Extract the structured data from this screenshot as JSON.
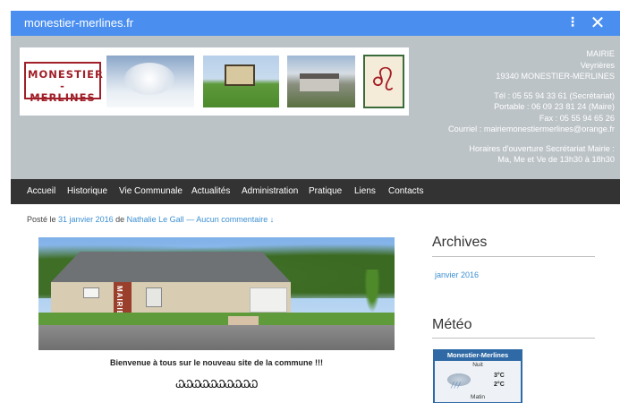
{
  "chrome": {
    "url": "monestier-merlines.fr",
    "menu_glyph": "⋮",
    "close_glyph": "✕",
    "bar_color": "#4a8ff0"
  },
  "header": {
    "logo_line1": "MONESTIER",
    "logo_line2": "- MERLINES",
    "contact": {
      "line1": "MAIRIE",
      "line2": "Veyrières",
      "line3": "19340 MONESTIER-MERLINES",
      "tel": "Tél : 05 55 94 33 61 (Secrétariat)",
      "portable": "Portable : 06 09 23 81 24 (Maire)",
      "fax": "Fax : 05 55 94 65 26",
      "courriel": "Courriel : mairiemonestiermerlines@orange.fr",
      "horaires_title": "Horaires d'ouverture Secrétariat Mairie :",
      "horaires": "Ma, Me et Ve de 13h30 à 18h30"
    },
    "crest_icon": "lion-icon"
  },
  "nav": {
    "items": [
      "Accueil",
      "Historique",
      "Vie Communale",
      "Actualités",
      "Administration",
      "Pratique",
      "Liens",
      "Contacts"
    ]
  },
  "post": {
    "posted_prefix": "Posté le",
    "date": "31 janvier 2016",
    "by": "de",
    "author": "Nathalie Le Gall",
    "dash": "—",
    "comments": "Aucun commentaire ↓",
    "photo_sign": "MAIRIE",
    "welcome": "Bienvenue à tous sur le nouveau site de la commune !!!",
    "ornament": "ᏇᏇᏇᏇᏇᏇᏇᏇᏇᏇ"
  },
  "sidebar": {
    "archives_title": "Archives",
    "archives_link": "janvier 2016",
    "meteo_title": "Météo",
    "weather": {
      "town": "Monestier-Merlines",
      "nuit": "Nuit",
      "tmax": "3°C",
      "tmin": "2°C",
      "matin": "Matin"
    }
  },
  "colors": {
    "header_bg": "#bcc3c7",
    "nav_bg": "#333333",
    "link": "#3c8fd2",
    "logo_red": "#a01f28"
  }
}
